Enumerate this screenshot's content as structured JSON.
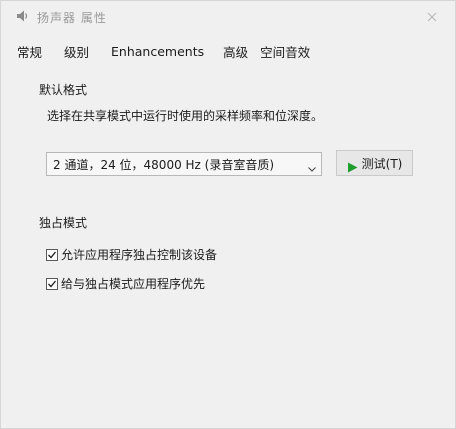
{
  "window": {
    "title": "扬声器 属性",
    "close_glyph": "✕"
  },
  "tabs": [
    {
      "label": "常规"
    },
    {
      "label": "级别"
    },
    {
      "label": "Enhancements"
    },
    {
      "label": "高级"
    },
    {
      "label": "空间音效"
    }
  ],
  "default_format": {
    "heading": "默认格式",
    "description": "选择在共享模式中运行时使用的采样频率和位深度。",
    "selected_format": "2 通道，24 位，48000 Hz (录音室音质)",
    "test_button": "测试(T)"
  },
  "exclusive_mode": {
    "heading": "独占模式",
    "options": [
      {
        "label": "允许应用程序独占控制该设备",
        "checked": true
      },
      {
        "label": "给与独占模式应用程序优先",
        "checked": true
      }
    ]
  },
  "colors": {
    "play_green": "#1e9c2e"
  },
  "icons": {
    "title": "speaker-icon",
    "close": "close-icon",
    "dropdown": "chevron-down-icon",
    "test": "play-icon",
    "check": "checkmark-icon"
  }
}
